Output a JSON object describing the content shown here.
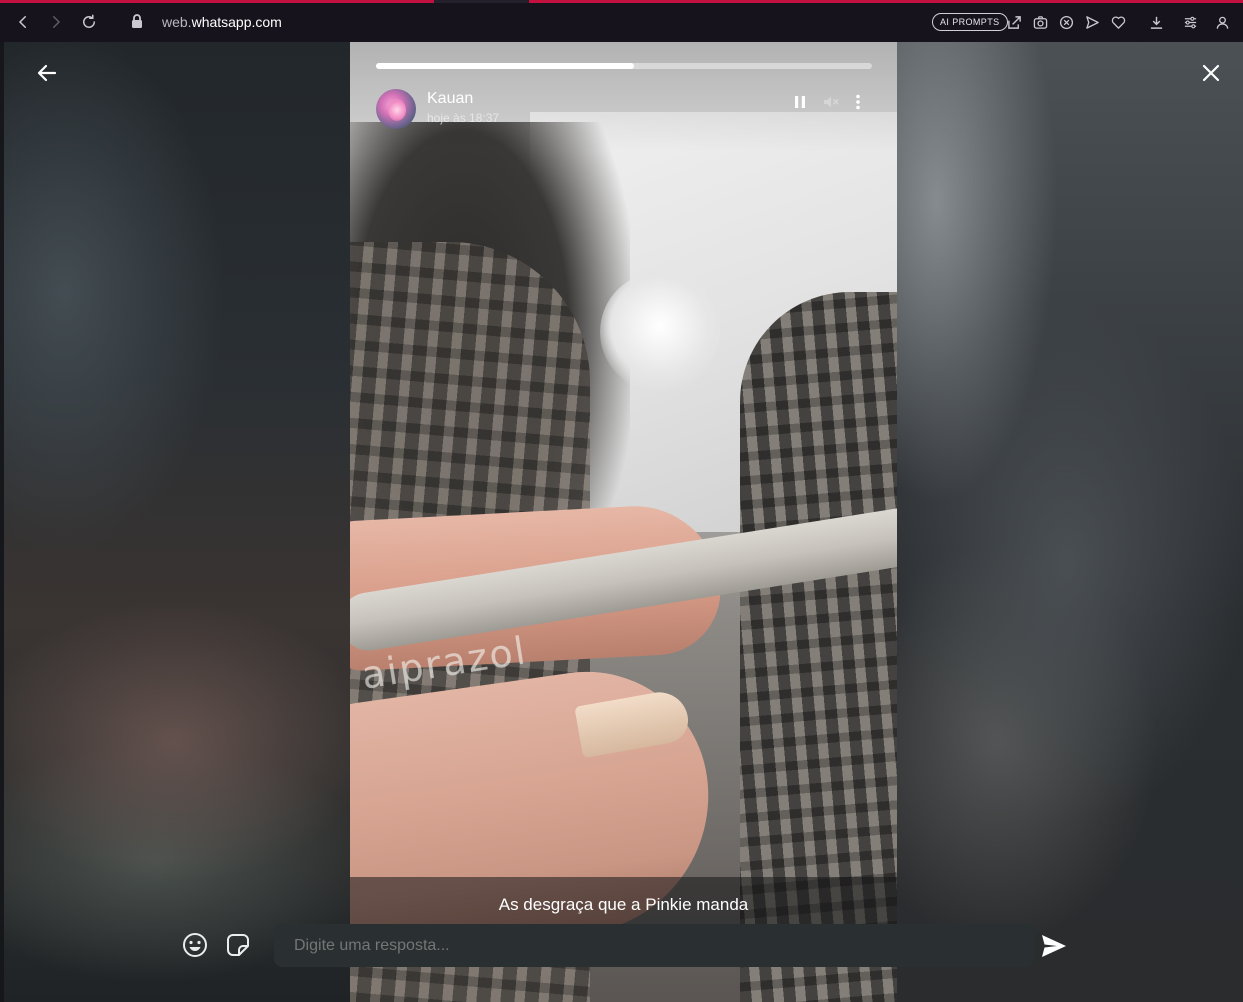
{
  "browser": {
    "url_prefix": "web.",
    "url_domain": "whatsapp.com",
    "ai_prompts_label": "AI PROMPTS",
    "accent_color": "#c3113f",
    "icons": [
      "back-arrow-icon",
      "forward-arrow-icon",
      "reload-icon",
      "lock-icon",
      "share-icon",
      "camera-icon",
      "close-circle-icon",
      "send-plane-icon",
      "heart-icon",
      "download-icon",
      "menu-icon",
      "profile-icon"
    ]
  },
  "status": {
    "contact_name": "Kauan",
    "timestamp": "hoje às 18:37",
    "progress": 0.52,
    "caption": "As desgraça que a Pinkie manda",
    "photo_text": "aiprazol",
    "controls": [
      "pause-icon",
      "mute-icon",
      "more-options-icon"
    ]
  },
  "reply": {
    "placeholder": "Digite uma resposta..."
  }
}
